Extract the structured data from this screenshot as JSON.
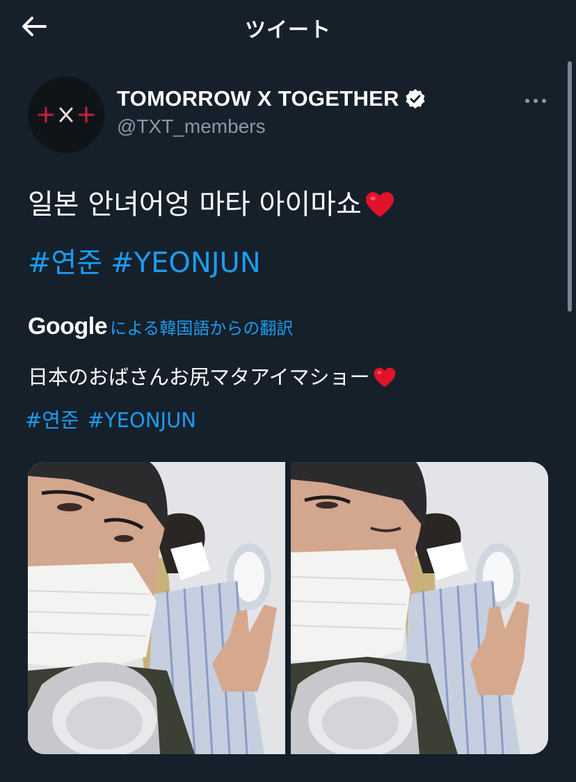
{
  "header": {
    "title": "ツイート",
    "back_icon": "arrow-left-icon"
  },
  "author": {
    "display_name": "TOMORROW X TOGETHER",
    "handle": "@TXT_members",
    "verified_icon": "verified-badge-icon",
    "avatar": "txt-logo-avatar"
  },
  "tweet": {
    "text": "일본 안녀어엉 마타 아이마쇼",
    "emoji": "heart-emoji",
    "hashtags": [
      "#연준",
      "#YEONJUN"
    ]
  },
  "translation": {
    "provider": "Google",
    "label": "による韓国語からの翻訳",
    "text": "日本のおばさんお尻マタアイマショー",
    "hashtags": [
      "#연준",
      "#YEONJUN"
    ]
  },
  "media": [
    {
      "description": "selfie-photo-1"
    },
    {
      "description": "selfie-photo-2"
    }
  ],
  "colors": {
    "background": "#15202b",
    "link": "#1d9bf0",
    "secondary_text": "#8b98a5"
  }
}
